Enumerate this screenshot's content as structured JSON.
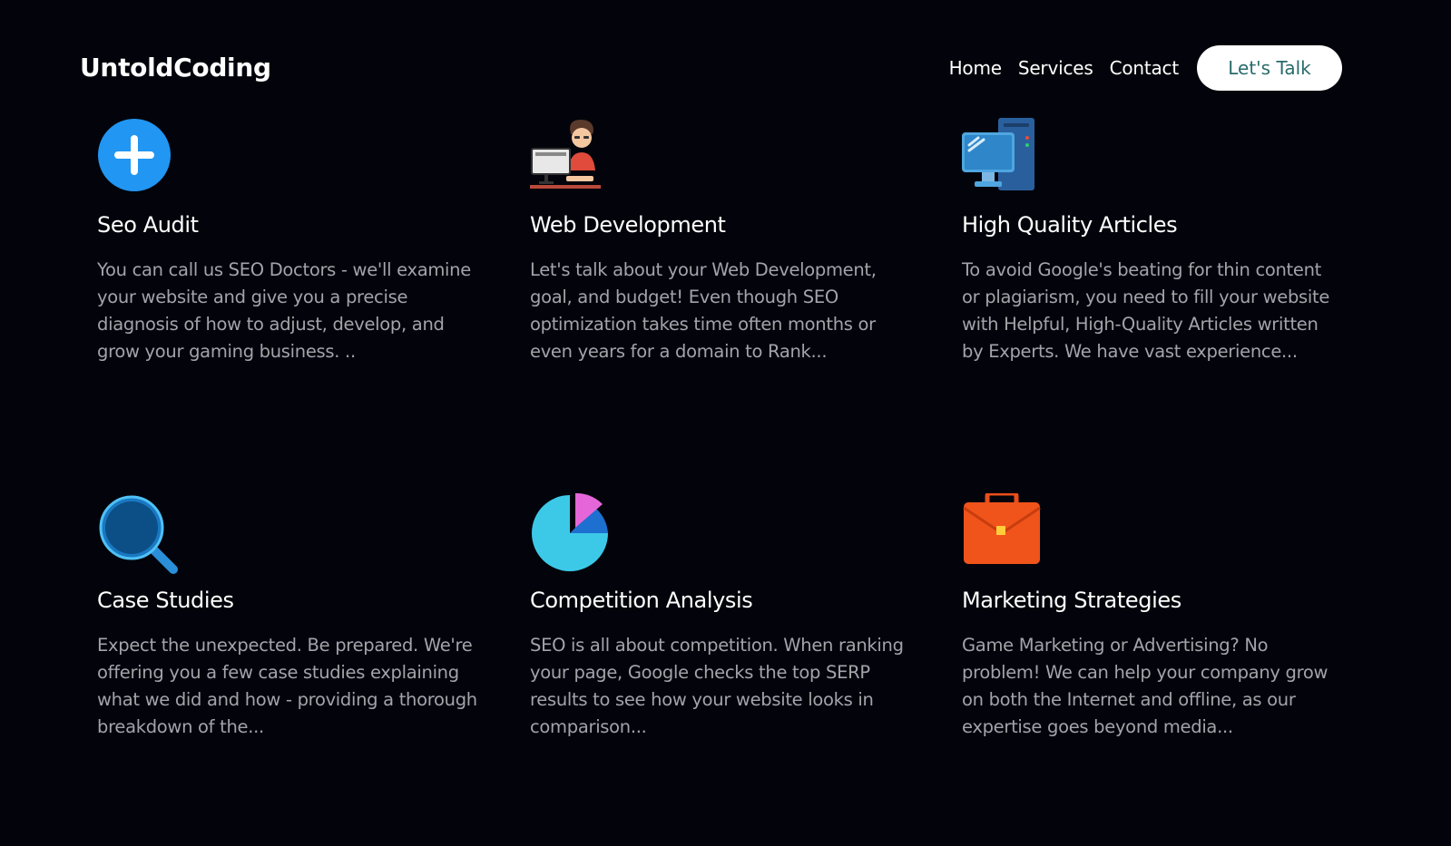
{
  "brand": {
    "name": "UntoldCoding"
  },
  "nav": {
    "links": [
      "Home",
      "Services",
      "Contact"
    ],
    "cta_label": "Let's Talk"
  },
  "services": [
    {
      "icon": "plus-circle-icon",
      "title": "Seo Audit",
      "text": "You can call us SEO Doctors - we'll examine your website and give you a precise diagnosis of how to adjust, develop, and grow your gaming business. .."
    },
    {
      "icon": "developer-at-computer-icon",
      "title": "Web Development",
      "text": "Let's talk about your Web Development, goal, and budget! Even though SEO optimization takes time often months or even years for a domain to Rank..."
    },
    {
      "icon": "desktop-computer-icon",
      "title": "High Quality Articles",
      "text": "To avoid Google's beating for thin content or plagiarism, you need to fill your website with Helpful, High-Quality Articles written by Experts. We have vast experience..."
    },
    {
      "icon": "magnifying-glass-icon",
      "title": "Case Studies",
      "text": "Expect the unexpected. Be prepared. We're offering you a few case studies explaining what we did and how - providing a thorough breakdown of the..."
    },
    {
      "icon": "pie-chart-icon",
      "title": "Competition Analysis",
      "text": "SEO is all about competition. When ranking your page, Google checks the top SERP results to see how your website looks in comparison..."
    },
    {
      "icon": "briefcase-icon",
      "title": "Marketing Strategies",
      "text": "Game Marketing or Advertising? No problem! We can help your company grow on both the Internet and offline, as our expertise goes beyond media..."
    }
  ],
  "colors": {
    "background": "#03040b",
    "heading": "#ffffff",
    "body_text": "#a3a4ab",
    "cta_text": "#2a6b6b",
    "accent_blue": "#2196f3"
  }
}
